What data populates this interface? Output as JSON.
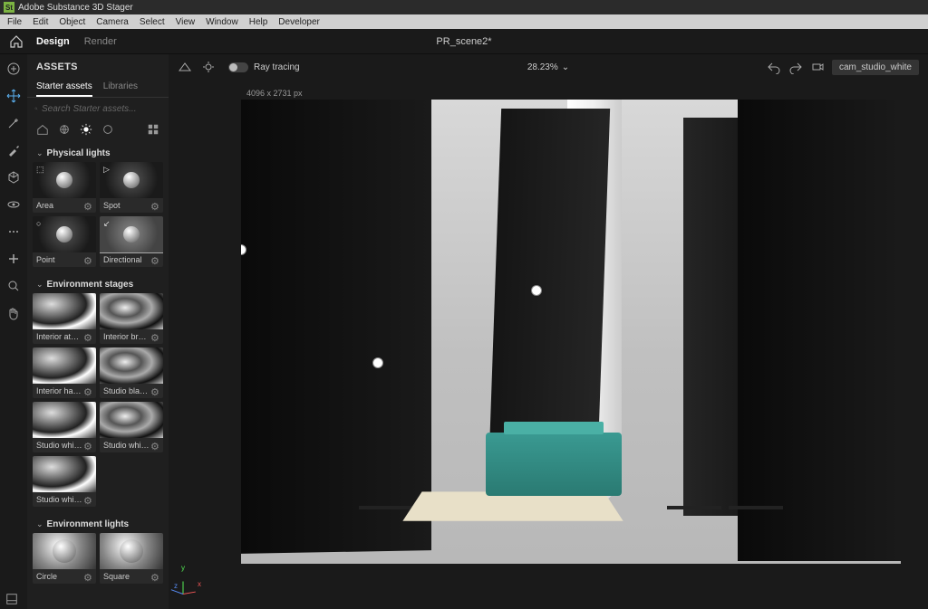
{
  "app": {
    "title": "Adobe Substance 3D Stager",
    "icon_label": "St"
  },
  "menu": [
    "File",
    "Edit",
    "Object",
    "Camera",
    "Select",
    "View",
    "Window",
    "Help",
    "Developer"
  ],
  "nav": {
    "home": "home-icon",
    "design": "Design",
    "render": "Render",
    "document": "PR_scene2*"
  },
  "tools": [
    "add",
    "move",
    "select",
    "rotate",
    "scale",
    "camera",
    "eye",
    "more",
    "plus",
    "search",
    "hand"
  ],
  "assets": {
    "header": "ASSETS",
    "tabs": {
      "starter": "Starter assets",
      "libraries": "Libraries"
    },
    "search_placeholder": "Search Starter assets...",
    "sections": {
      "physical_lights": {
        "title": "Physical lights",
        "items": [
          {
            "label": "Area",
            "icon": "⬚"
          },
          {
            "label": "Spot",
            "icon": "▷"
          },
          {
            "label": "Point",
            "icon": "○"
          },
          {
            "label": "Directional",
            "icon": "↙"
          }
        ]
      },
      "env_stages": {
        "title": "Environment stages",
        "items": [
          {
            "label": "Interior atelier s…"
          },
          {
            "label": "Interior brutalist…"
          },
          {
            "label": "Interior haussm…"
          },
          {
            "label": "Studio black soft…"
          },
          {
            "label": "Studio white ha…"
          },
          {
            "label": "Studio white so…"
          },
          {
            "label": "Studio white um…"
          }
        ]
      },
      "env_lights": {
        "title": "Environment lights",
        "items": [
          {
            "label": "Circle"
          },
          {
            "label": "Square"
          }
        ]
      }
    }
  },
  "viewport": {
    "ray_tracing_label": "Ray tracing",
    "zoom": "28.23%",
    "resolution": "4096 x 2731 px",
    "camera": "cam_studio_white"
  }
}
